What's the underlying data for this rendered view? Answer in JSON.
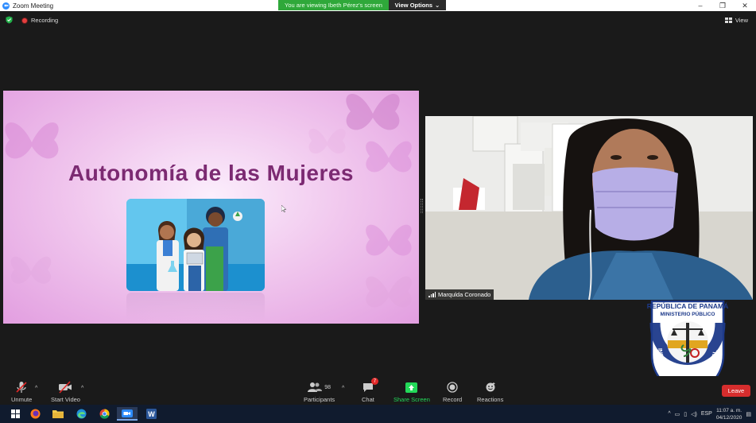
{
  "window": {
    "title": "Zoom Meeting",
    "minimize": "–",
    "restore": "❐",
    "close": "✕"
  },
  "share_banner": {
    "message": "You are viewing Ibeth Pérez's screen",
    "options_label": "View Options"
  },
  "status": {
    "recording_label": "Recording",
    "view_label": "View"
  },
  "slide": {
    "title": "Autonomía de las Mujeres"
  },
  "video": {
    "participant_name": "Marqulda Coronado"
  },
  "seal": {
    "text_top": "REPÚBLICA DE PANAMÁ",
    "text_sub": "MINISTERIO PÚBLICO",
    "ring_text": "INSTITUTO DE MEDICINA LEGAL Y CIENCIAS FORENSES"
  },
  "toolbar": {
    "unmute": "Unmute",
    "start_video": "Start Video",
    "participants": "Participants",
    "participants_count": "98",
    "chat": "Chat",
    "chat_badge": "7",
    "share_screen": "Share Screen",
    "record": "Record",
    "reactions": "Reactions",
    "leave": "Leave"
  },
  "taskbar": {
    "apps": [
      "windows-start",
      "firefox",
      "file-explorer",
      "edge",
      "chrome",
      "zoom",
      "word"
    ],
    "time": "11:07 a. m.",
    "date": "04/12/2020",
    "language": "ESP"
  },
  "colors": {
    "share_green": "#2fa83a",
    "slide_title": "#7c2a72",
    "leave_red": "#d62d2d",
    "share_screen_green": "#23d959"
  }
}
